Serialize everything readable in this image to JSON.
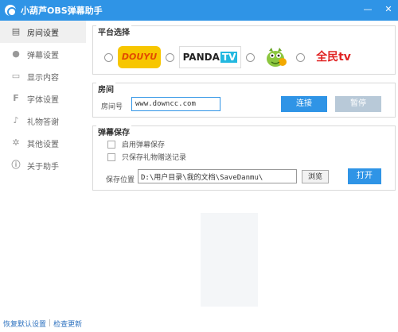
{
  "window": {
    "title": "小葫芦OBS弹幕助手",
    "minimize": "—",
    "close": "✕"
  },
  "sidebar": {
    "items": [
      {
        "label": "房间设置",
        "icon": "building-icon",
        "glyph": "▤",
        "active": true
      },
      {
        "label": "弹幕设置",
        "icon": "chat-bubble-icon",
        "glyph": "●"
      },
      {
        "label": "显示内容",
        "icon": "monitor-icon",
        "glyph": "▭"
      },
      {
        "label": "字体设置",
        "icon": "font-icon",
        "glyph": "F"
      },
      {
        "label": "礼物答谢",
        "icon": "gift-icon",
        "glyph": "♪"
      },
      {
        "label": "其他设置",
        "icon": "gear-icon",
        "glyph": "✲"
      },
      {
        "label": "关于助手",
        "icon": "info-icon",
        "glyph": "ⓘ"
      }
    ]
  },
  "platform": {
    "title": "平台选择",
    "options": [
      {
        "name": "douyu",
        "logo_text": "DOUYU"
      },
      {
        "name": "panda",
        "logo_text_a": "PANDA",
        "logo_text_b": "TV"
      },
      {
        "name": "longzhu",
        "logo_text": ""
      },
      {
        "name": "quanmin",
        "logo_text": "全民tv"
      }
    ]
  },
  "room": {
    "title": "房间",
    "label": "房间号",
    "value": "www.downcc.com",
    "connect_label": "连接",
    "pause_label": "暂停"
  },
  "save": {
    "title": "弹幕保存",
    "opt_enable": "启用弹幕保存",
    "opt_gift_only": "只保存礼物赠送记录",
    "path_label": "保存位置",
    "path_value": "D:\\用户目录\\我的文档\\SaveDanmu\\",
    "browse_label": "浏览",
    "open_label": "打开"
  },
  "footer": {
    "restore": "恢复默认设置",
    "separator": "|",
    "update": "检查更新"
  },
  "colors": {
    "accent": "#2f94e6",
    "disabled": "#b8c9d8",
    "link": "#2f73c0"
  }
}
